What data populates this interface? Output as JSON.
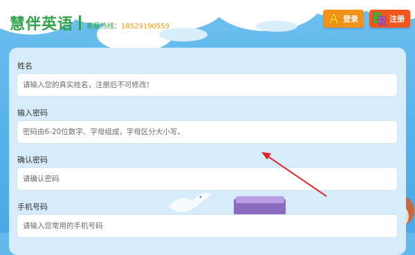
{
  "header": {
    "logo_text": "慧伴英语",
    "hotline_label": "客服热线：",
    "hotline_number": "18529190559",
    "login_label": "登录",
    "register_label": "注册"
  },
  "form": {
    "fields": [
      {
        "label": "姓名",
        "placeholder": "请输入您的真实姓名，注册后不可修改！"
      },
      {
        "label": "输入密码",
        "placeholder": "密码由6-20位数字、字母组成，字母区分大小写。"
      },
      {
        "label": "确认密码",
        "placeholder": "请确认密码"
      },
      {
        "label": "手机号码",
        "placeholder": "请输入您常用的手机号码"
      }
    ]
  },
  "colors": {
    "brand_green": "#2fa24a",
    "hotline_orange": "#f29b15",
    "login_bg": "#f29317",
    "register_bg": "#f0561d",
    "arrow_red": "#e0262b"
  }
}
